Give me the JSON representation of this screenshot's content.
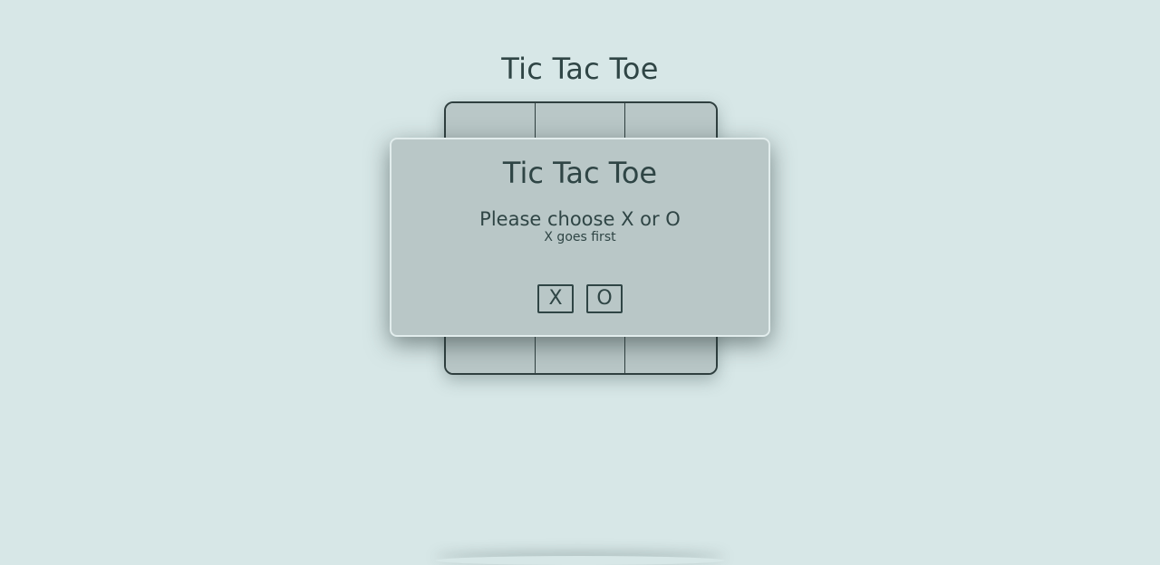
{
  "page": {
    "title": "Tic Tac Toe"
  },
  "board": {
    "cells": [
      "",
      "",
      "",
      "",
      "",
      "",
      "",
      "",
      ""
    ]
  },
  "modal": {
    "title": "Tic Tac Toe",
    "prompt": "Please choose X or O",
    "subtitle": "X goes first",
    "choices": {
      "x_label": "X",
      "o_label": "O"
    }
  },
  "colors": {
    "background": "#d7e7e7",
    "panel": "#b9c7c7",
    "text": "#2f4545"
  }
}
